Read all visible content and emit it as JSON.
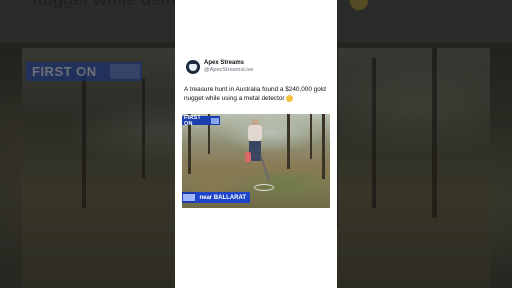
{
  "background": {
    "overlay_caption": "nugget while using a metal detector",
    "overlay_badge": "FIRST ON"
  },
  "post": {
    "account_name": "Apex Streams",
    "account_handle": "@ApexStreamsLive",
    "text": "A treasure hunt in Australia found a $240,000 gold nugget while using a metal detector",
    "emoji_icon": "grinning-face-emoji"
  },
  "video": {
    "badge_label": "FIRST ON",
    "location_label": "near BALLARAT",
    "channel_logo_icon": "nine-network-logo",
    "colors": {
      "badge_blue": "#1b3fae",
      "location_blue": "#1f46c9"
    }
  }
}
